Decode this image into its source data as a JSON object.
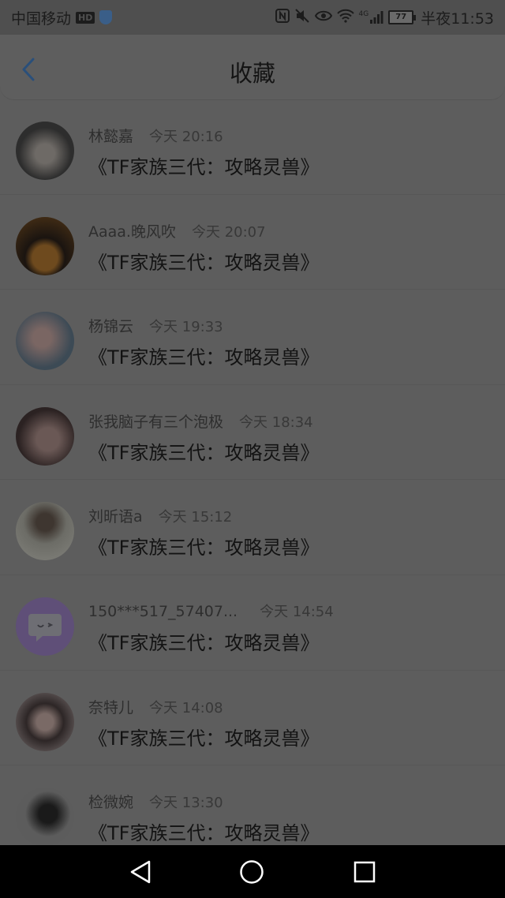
{
  "status_bar": {
    "carrier": "中国移动",
    "hd": "HD",
    "battery": "77",
    "time": "半夜11:53",
    "network": "4G"
  },
  "header": {
    "title": "收藏"
  },
  "items": [
    {
      "name": "林懿嘉",
      "time": "今天 20:16",
      "title": "《TF家族三代：攻略灵兽》",
      "avatar_color": "#2d2d2d"
    },
    {
      "name": "Aaaa.晚风吹",
      "time": "今天 20:07",
      "title": "《TF家族三代：攻略灵兽》",
      "avatar_color": "#4a3418"
    },
    {
      "name": "杨锦云",
      "time": "今天 19:33",
      "title": "《TF家族三代：攻略灵兽》",
      "avatar_color": "#5a4a48"
    },
    {
      "name": "张我脑子有三个泡极",
      "time": "今天 18:34",
      "title": "《TF家族三代：攻略灵兽》",
      "avatar_color": "#3b2d2d"
    },
    {
      "name": "刘昕语a",
      "time": "今天 15:12",
      "title": "《TF家族三代：攻略灵兽》",
      "avatar_color": "#6a6a62"
    },
    {
      "name": "150***517_57407...",
      "time": "今天 14:54",
      "title": "《TF家族三代：攻略灵兽》",
      "avatar_color": "#5f4f78"
    },
    {
      "name": "奈特儿",
      "time": "今天 14:08",
      "title": "《TF家族三代：攻略灵兽》",
      "avatar_color": "#4d4545"
    },
    {
      "name": "检微婉",
      "time": "今天 13:30",
      "title": "《TF家族三代：攻略灵兽》",
      "avatar_color": "#555555"
    }
  ]
}
